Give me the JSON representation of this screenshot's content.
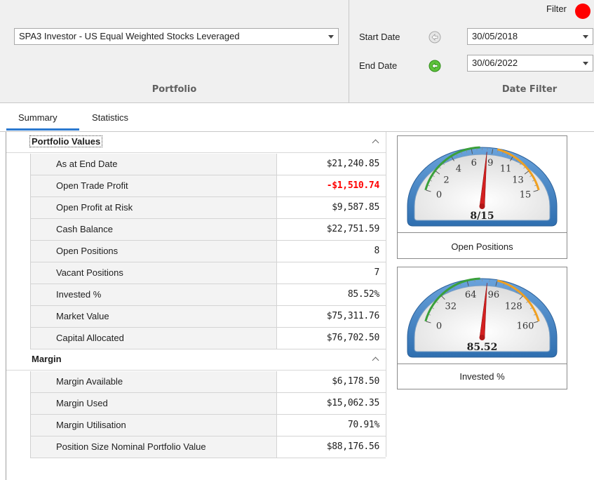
{
  "ribbon": {
    "portfolio_select": "SPA3 Investor - US Equal Weighted Stocks Leveraged",
    "portfolio_caption": "Portfolio",
    "start_date_label": "Start Date",
    "end_date_label": "End Date",
    "start_date_value": "30/05/2018",
    "end_date_value": "30/06/2022",
    "date_filter_caption": "Date Filter",
    "filter_label": "Filter",
    "filter_color": "#ff0000"
  },
  "tabs": [
    "Summary",
    "Statistics"
  ],
  "groups": [
    {
      "title": "Portfolio Values",
      "rows": [
        {
          "name": "As at End Date",
          "value": "$21,240.85"
        },
        {
          "name": "Open Trade Profit",
          "value": "-$1,510.74",
          "negative": true
        },
        {
          "name": "Open Profit at Risk",
          "value": "$9,587.85"
        },
        {
          "name": "Cash Balance",
          "value": "$22,751.59"
        },
        {
          "name": "Open Positions",
          "value": "8"
        },
        {
          "name": "Vacant Positions",
          "value": "7"
        },
        {
          "name": "Invested %",
          "value": "85.52%"
        },
        {
          "name": "Market Value",
          "value": "$75,311.76"
        },
        {
          "name": "Capital Allocated",
          "value": "$76,702.50"
        }
      ]
    },
    {
      "title": "Margin",
      "rows": [
        {
          "name": "Margin Available",
          "value": "$6,178.50"
        },
        {
          "name": "Margin Used",
          "value": "$15,062.35"
        },
        {
          "name": "Margin Utilisation",
          "value": "70.91%"
        },
        {
          "name": "Position Size Nominal Portfolio Value",
          "value": "$88,176.56"
        }
      ]
    }
  ],
  "gauges": [
    {
      "caption": "Open Positions",
      "readout": "8/15",
      "ticks": [
        "0",
        "2",
        "4",
        "6",
        "9",
        "11",
        "13",
        "15"
      ],
      "min": 0,
      "max": 15,
      "value": 8
    },
    {
      "caption": "Invested %",
      "readout": "85.52",
      "ticks": [
        "0",
        "32",
        "64",
        "96",
        "128",
        "160"
      ],
      "min": 0,
      "max": 160,
      "value": 85.52
    }
  ],
  "colors": {
    "accent_tab": "#2b79d0",
    "negative_value": "#ff0000",
    "gauge_frame": "#2f6fb0",
    "gauge_needle": "#d42020",
    "gauge_green_band": "#3aa03a",
    "gauge_orange_band": "#f0a020"
  },
  "icons": {
    "start_nav": "circle-arrow-left-disabled-icon",
    "end_nav": "circle-arrow-left-green-icon",
    "collapse": "chevron-up-icon"
  }
}
